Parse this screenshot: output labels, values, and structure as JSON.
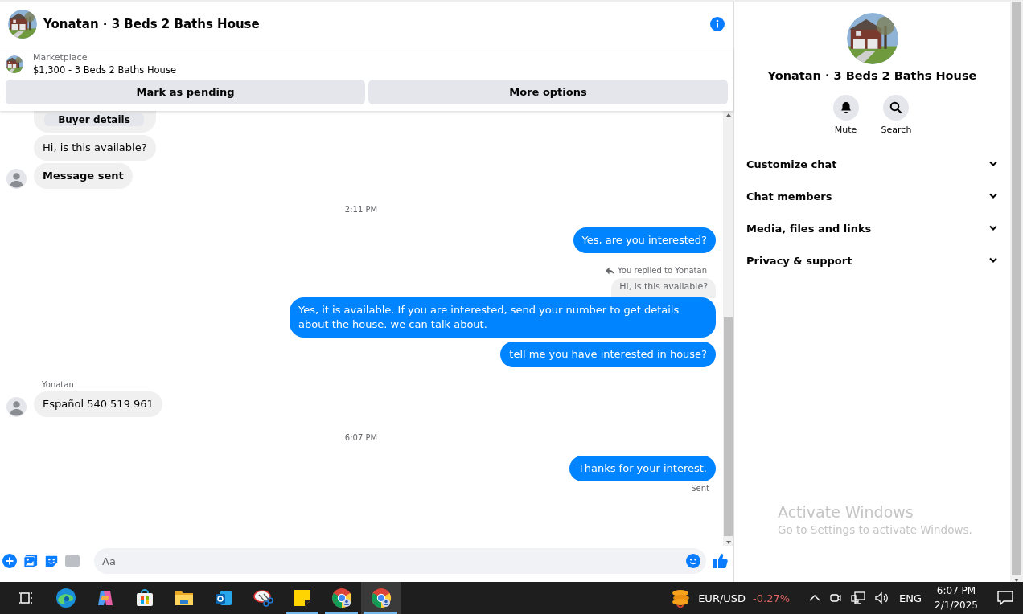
{
  "header": {
    "title": "Yonatan · 3 Beds 2 Baths House"
  },
  "listing": {
    "label": "Marketplace",
    "title": "$1,300 - 3 Beds 2 Baths House",
    "buttons": [
      "Mark as pending",
      "More options"
    ]
  },
  "messages": [
    {
      "kind": "button_card",
      "text": "Buyer details"
    },
    {
      "kind": "incoming",
      "text": "Hi, is this available?",
      "avatar": false,
      "bold": false
    },
    {
      "kind": "incoming",
      "text": "Message sent",
      "avatar": true,
      "bold": true
    },
    {
      "kind": "time",
      "text": "2:11 PM"
    },
    {
      "kind": "outgoing",
      "text": "Yes, are you interested?"
    },
    {
      "kind": "reply_label",
      "text": "You replied to Yonatan"
    },
    {
      "kind": "quote",
      "text": "Hi, is this available?"
    },
    {
      "kind": "outgoing",
      "text": "Yes, it is available. If you are interested, send your number to get details about the house. we can talk about."
    },
    {
      "kind": "outgoing",
      "text": "tell me you have interested in house?"
    },
    {
      "kind": "sender",
      "text": "Yonatan"
    },
    {
      "kind": "incoming",
      "text": "Español 540 519 961",
      "avatar": true,
      "bold": false
    },
    {
      "kind": "time",
      "text": "6:07 PM"
    },
    {
      "kind": "outgoing",
      "text": "Thanks for your interest."
    },
    {
      "kind": "status",
      "text": "Sent"
    }
  ],
  "composer": {
    "placeholder": "Aa"
  },
  "details": {
    "title": "Yonatan · 3 Beds 2 Baths House",
    "actions": [
      {
        "kind": "bell",
        "label": "Mute"
      },
      {
        "kind": "search",
        "label": "Search"
      }
    ],
    "sections": [
      {
        "label": "Customize chat",
        "expanded": false
      },
      {
        "label": "Chat members",
        "expanded": false
      },
      {
        "label": "Media, files and links",
        "expanded": false
      },
      {
        "label": "Privacy & support",
        "expanded": false
      }
    ]
  },
  "activation": {
    "title": "Activate Windows",
    "hint": "Go to Settings to activate Windows."
  },
  "taskbar": {
    "apps": [
      {
        "kind": "taskview",
        "running": false,
        "selected": false
      },
      {
        "kind": "edge",
        "running": false,
        "selected": false
      },
      {
        "kind": "copilot",
        "running": false,
        "selected": false
      },
      {
        "kind": "store",
        "running": false,
        "selected": false
      },
      {
        "kind": "folder",
        "running": false,
        "selected": false
      },
      {
        "kind": "mail",
        "running": false,
        "selected": false
      },
      {
        "kind": "scissors",
        "running": false,
        "selected": false
      },
      {
        "kind": "note",
        "running": true,
        "selected": false
      },
      {
        "kind": "chrome",
        "running": true,
        "selected": false
      },
      {
        "kind": "chrome",
        "running": true,
        "selected": true
      }
    ],
    "ticker": {
      "pair": "EUR/USD",
      "change": "-0.27%"
    },
    "language": "ENG",
    "time": "6:07 PM",
    "date": "2/1/2025"
  }
}
